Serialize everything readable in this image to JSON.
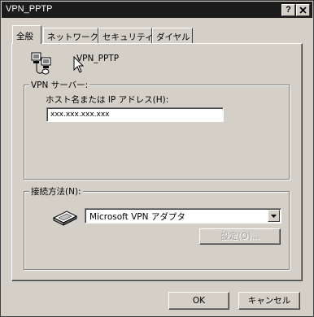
{
  "window": {
    "title": "VPN_PPTP",
    "help_button": "?",
    "close_button": "X"
  },
  "tabs": [
    {
      "label": "全般",
      "active": true
    },
    {
      "label": "ネットワーク",
      "active": false
    },
    {
      "label": "セキュリティ",
      "active": false
    },
    {
      "label": "ダイヤル",
      "active": false
    }
  ],
  "general": {
    "connection_name": "VPN_PPTP",
    "connection_icon": "network-connection-icon",
    "vpn_server": {
      "group_label": "VPN サーバー:",
      "host_label": "ホスト名または IP アドレス(H):",
      "host_value": "xxx.xxx.xxx.xxx"
    },
    "connect_using": {
      "group_label": "接続方法(N):",
      "device_icon": "modem-device-icon",
      "device_selected": "Microsoft VPN アダプタ",
      "configure_label": "設定(O)..."
    }
  },
  "footer": {
    "ok_label": "OK",
    "cancel_label": "キャンセル"
  }
}
